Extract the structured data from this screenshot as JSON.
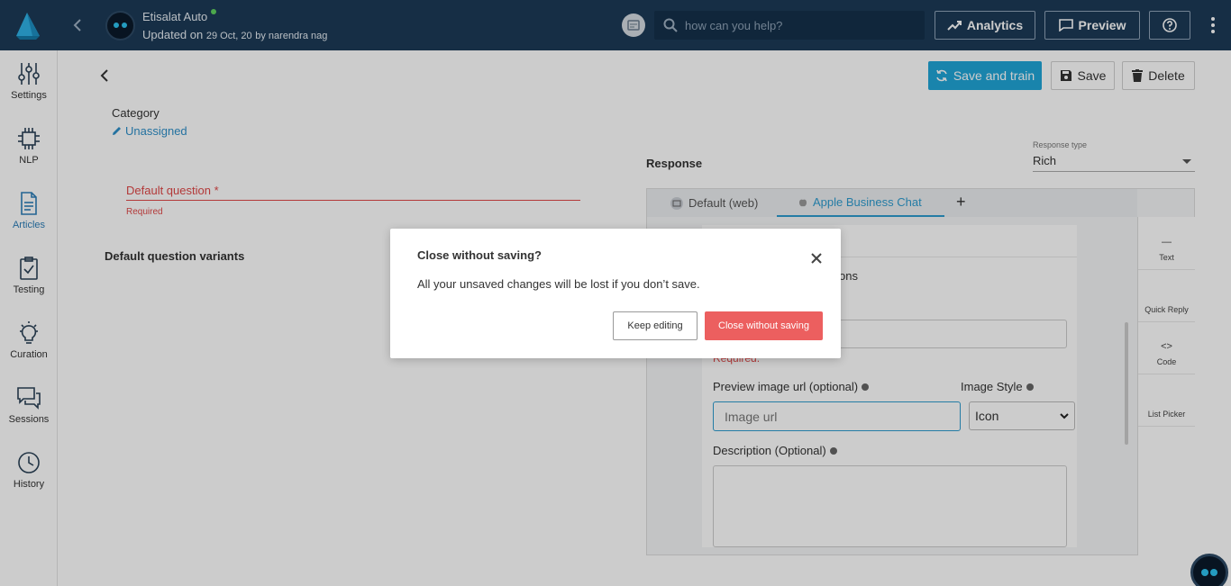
{
  "header": {
    "bot_name": "Etisalat Auto",
    "updated_prefix": "Updated on",
    "updated_date": "29 Oct, 20",
    "updated_by": "by narendra nag",
    "search_placeholder": "how can you help?",
    "analytics_label": "Analytics",
    "preview_label": "Preview"
  },
  "sidebar": {
    "items": [
      {
        "label": "Settings",
        "icon": "sliders-icon"
      },
      {
        "label": "NLP",
        "icon": "chip-icon"
      },
      {
        "label": "Articles",
        "icon": "document-icon",
        "active": true
      },
      {
        "label": "Testing",
        "icon": "clipboard-check-icon"
      },
      {
        "label": "Curation",
        "icon": "lightbulb-icon"
      },
      {
        "label": "Sessions",
        "icon": "chat-bubbles-icon"
      },
      {
        "label": "History",
        "icon": "clock-icon"
      }
    ]
  },
  "actions": {
    "save_train_label": "Save and train",
    "save_label": "Save",
    "delete_label": "Delete"
  },
  "article": {
    "category_label": "Category",
    "category_value": "Unassigned",
    "default_question_label": "Default question *",
    "required_text": "Required",
    "variants_label": "Default question variants"
  },
  "response": {
    "title": "Response",
    "type_label": "Response type",
    "type_value": "Rich",
    "tabs": [
      {
        "label": "Default (web)"
      },
      {
        "label": "Apple Business Chat",
        "active": true
      }
    ],
    "add_tab": "+",
    "partial_options_text": "ons",
    "required_text": "Required.",
    "preview_image_label": "Preview image url (optional)",
    "preview_image_placeholder": "Image url",
    "image_style_label": "Image Style",
    "image_style_value": "Icon",
    "description_label": "Description (Optional)",
    "tools": [
      {
        "label": "Text",
        "glyph": "—"
      },
      {
        "label": "Quick Reply",
        "glyph": ""
      },
      {
        "label": "Code",
        "glyph": "<>"
      },
      {
        "label": "List Picker",
        "glyph": ""
      }
    ]
  },
  "modal": {
    "title": "Close without saving?",
    "body": "All your unsaved changes will be lost if you don’t save.",
    "keep_label": "Keep editing",
    "discard_label": "Close without saving"
  },
  "colors": {
    "topbar": "#1c3a57",
    "accent": "#20a5d8",
    "danger": "#ec5f5f",
    "link": "#2e8fc9"
  }
}
